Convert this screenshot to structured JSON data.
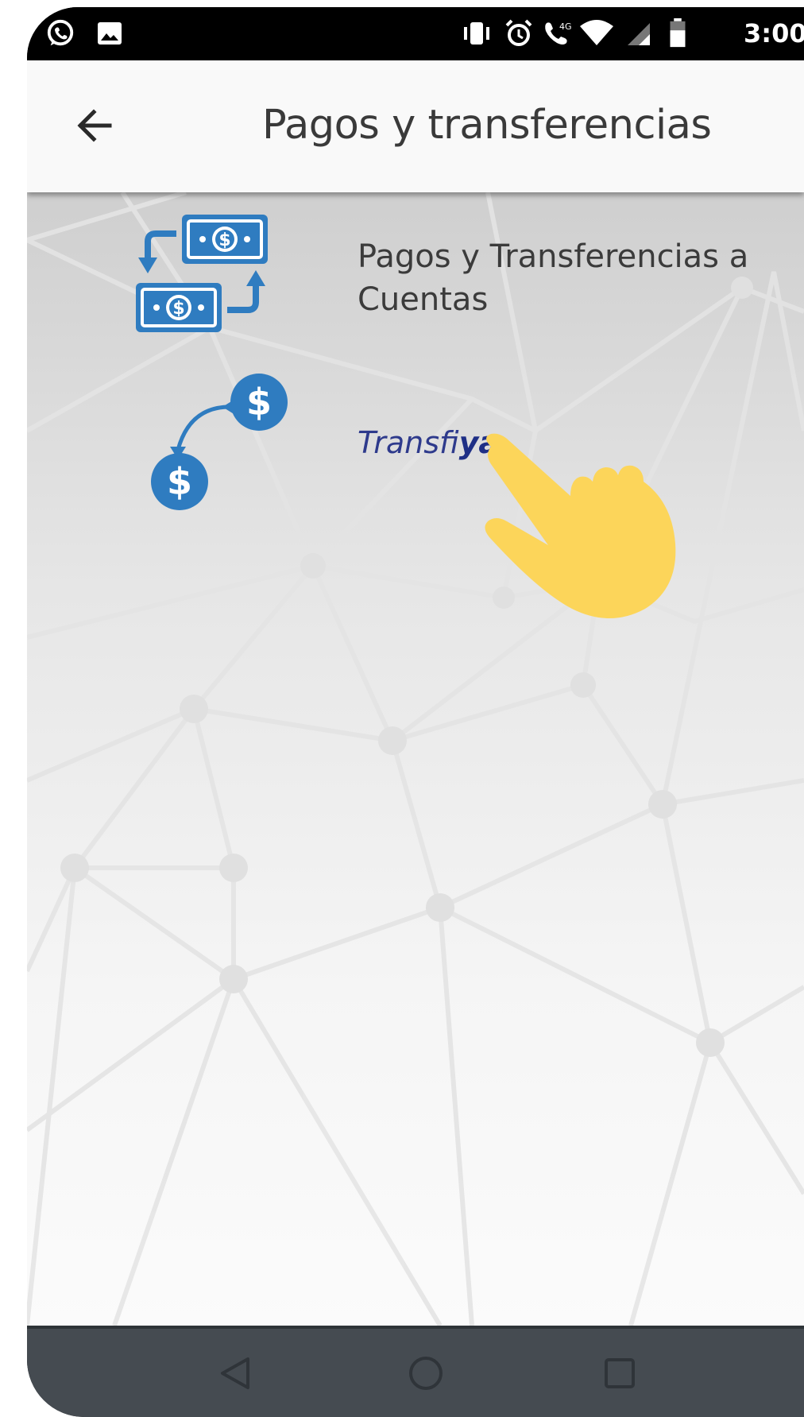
{
  "status_bar": {
    "time": "3:00",
    "icons": [
      "whatsapp-icon",
      "image-icon",
      "vibrate-icon",
      "alarm-icon",
      "call-icon",
      "wifi-icon",
      "signal-icon",
      "battery-icon"
    ]
  },
  "app_bar": {
    "back_icon": "arrow-left-icon",
    "title": "Pagos y transferencias"
  },
  "menu": {
    "items": [
      {
        "label": "Pagos y Transferencias a Cuentas",
        "icon": "money-transfer-icon"
      },
      {
        "label_regular": "Transfi",
        "label_bold": "ya",
        "icon": "dollar-transfer-icon"
      }
    ]
  },
  "overlay": {
    "icon": "pointing-hand-icon"
  },
  "nav_bar": {
    "buttons": [
      "back-triangle-icon",
      "home-circle-icon",
      "recents-square-icon"
    ]
  },
  "colors": {
    "accent_blue": "#2f7cc0",
    "title_text": "#3a3a3a",
    "transfiya_blue": "#1f2f86",
    "hand_yellow": "#fcd55a",
    "nav_bar": "#454b51",
    "status_bar": "#000000"
  }
}
